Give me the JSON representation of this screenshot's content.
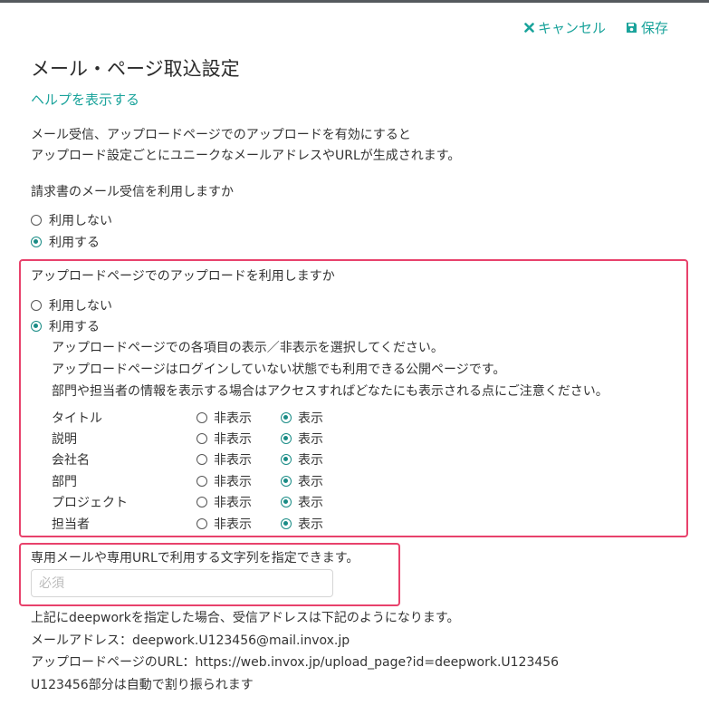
{
  "toolbar": {
    "cancel_label": "キャンセル",
    "save_label": "保存"
  },
  "page": {
    "title": "メール・ページ取込設定",
    "help_link": "ヘルプを表示する",
    "description": [
      "メール受信、アップロードページでのアップロードを有効にすると",
      "アップロード設定ごとにユニークなメールアドレスやURLが生成されます。"
    ]
  },
  "mail_receive": {
    "question": "請求書のメール受信を利用しますか",
    "options": [
      "利用しない",
      "利用する"
    ],
    "selected": "利用する"
  },
  "upload_page": {
    "question": "アップロードページでのアップロードを利用しますか",
    "options": [
      "利用しない",
      "利用する"
    ],
    "selected": "利用する",
    "notes": [
      "アップロードページでの各項目の表示／非表示を選択してください。",
      "アップロードページはログインしていない状態でも利用できる公開ページです。",
      "部門や担当者の情報を表示する場合はアクセスすればどなたにも表示される点にご注意ください。"
    ],
    "hide_label": "非表示",
    "show_label": "表示",
    "fields": [
      {
        "name": "タイトル",
        "selected": "表示"
      },
      {
        "name": "説明",
        "selected": "表示"
      },
      {
        "name": "会社名",
        "selected": "表示"
      },
      {
        "name": "部門",
        "selected": "表示"
      },
      {
        "name": "プロジェクト",
        "selected": "表示"
      },
      {
        "name": "担当者",
        "selected": "表示"
      }
    ]
  },
  "dedicated_string": {
    "question": "専用メールや専用URLで利用する文字列を指定できます。",
    "placeholder": "必須",
    "value": ""
  },
  "footer": {
    "lines": [
      "上記にdeepworkを指定した場合、受信アドレスは下記のようになります。",
      "メールアドレス：deepwork.U123456@mail.invox.jp",
      "アップロードページのURL：https://web.invox.jp/upload_page?id=deepwork.U123456",
      "U123456部分は自動で割り振られます"
    ]
  },
  "colors": {
    "accent": "#1aa39b",
    "radio_selected": "#1a8c86",
    "highlight_border": "#e8426c",
    "top_bar": "#555a5e"
  }
}
